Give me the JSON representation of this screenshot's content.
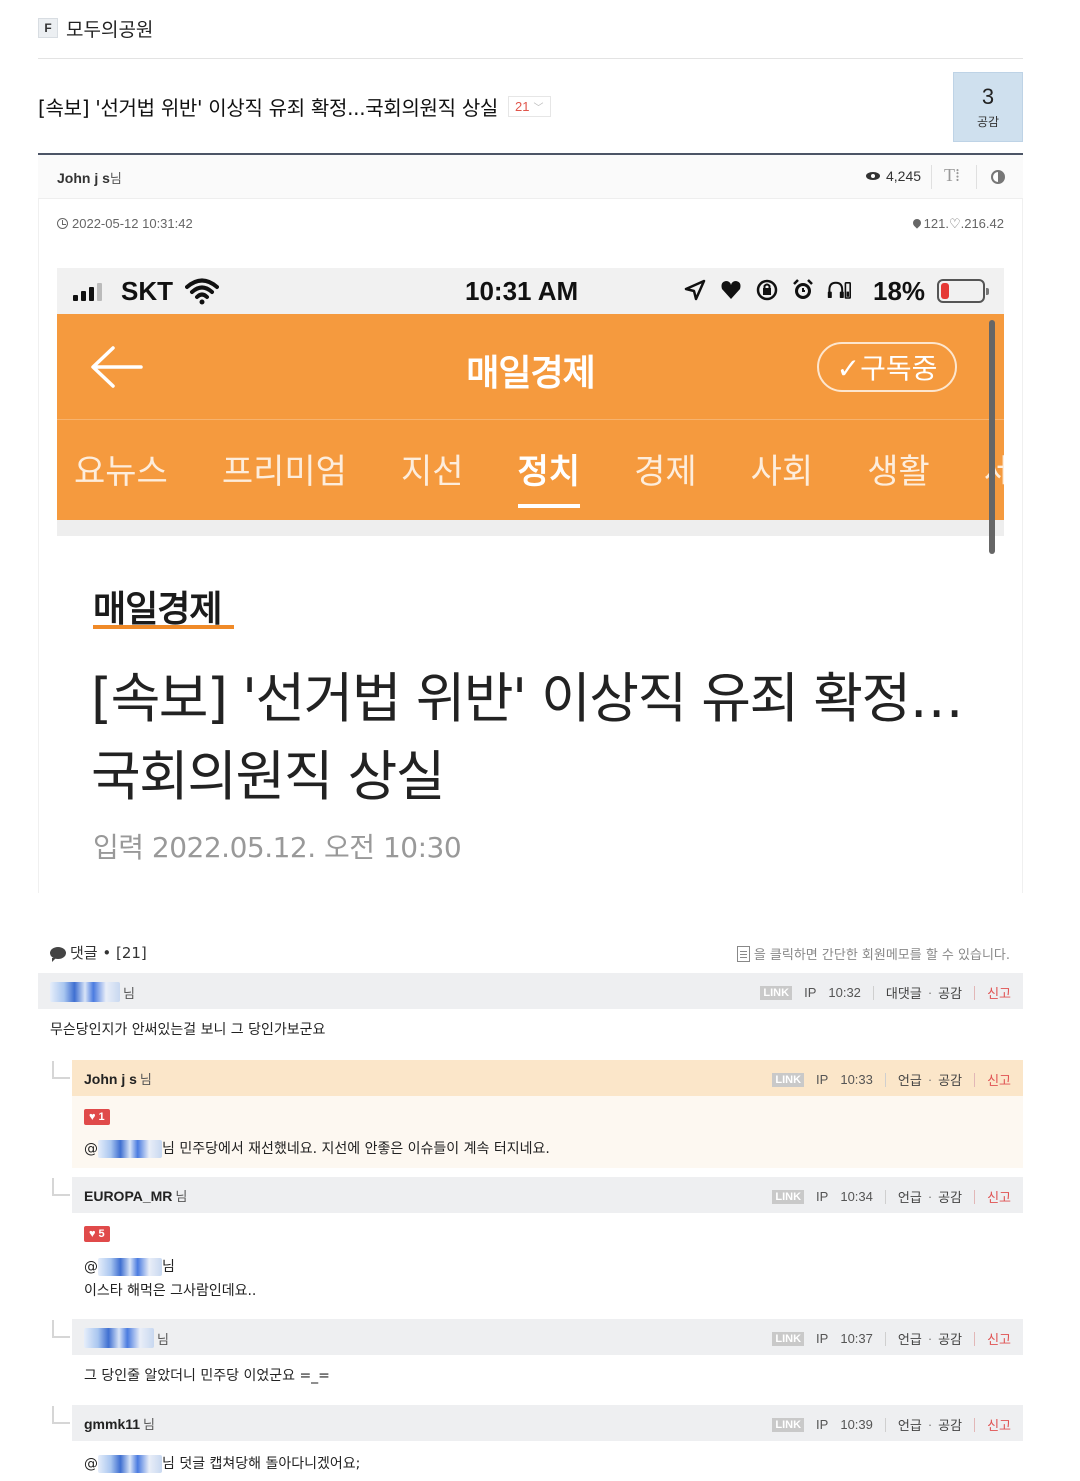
{
  "board": {
    "badge": "F",
    "name": "모두의공원"
  },
  "post": {
    "title": "[속보] '선거법 위반' 이상직 유죄 확정...국회의원직 상실",
    "comment_count": "21",
    "like_count": "3",
    "like_label": "공감",
    "author": "John j s",
    "author_suffix": "님",
    "views": "4,245",
    "font_tool": "T⁞",
    "date": "2022-05-12 10:31:42",
    "ip": "121.♡.216.42"
  },
  "screenshot": {
    "carrier": "SKT",
    "time": "10:31 AM",
    "battery": "18%",
    "app_title": "매일경제",
    "subscribe_label": "✓구독중",
    "tabs": [
      "요뉴스",
      "프리미엄",
      "지선",
      "정치",
      "경제",
      "사회",
      "생활",
      "세계"
    ],
    "active_tab": "정치",
    "logo": "매일경제",
    "headline": "[속보] '선거법 위반' 이상직 유죄 확정…국회의원직 상실",
    "input_date": "입력 2022.05.12. 오전 10:30"
  },
  "comments_header": {
    "label": "댓글 • [21]",
    "memo_tip": "을 클릭하면 간단한 회원메모를 할 수 있습니다."
  },
  "comment_labels": {
    "link": "LINK",
    "ip": "IP",
    "reply": "대댓글",
    "mention": "언급",
    "like": "공감",
    "report": "신고",
    "dot": "·",
    "nim": "님"
  },
  "comments": [
    {
      "user": "",
      "time": "10:32",
      "text": "무슨당인지가 안써있는걸 보니 그 당인가보군요"
    },
    {
      "user": "John j s",
      "time": "10:33",
      "likes": "1",
      "text_prefix": "@",
      "text": "님 민주당에서 재선했네요. 지선에 안좋은 이슈들이 계속 터지네요."
    },
    {
      "user": "EUROPA_MR",
      "time": "10:34",
      "likes": "5",
      "text_prefix": "@",
      "text_nim": "님",
      "text": "이스타 해먹은 그사람인데요.."
    },
    {
      "user": "",
      "time": "10:37",
      "text": "그 당인줄 알았더니 민주당 이었군요 =_="
    },
    {
      "user": "gmmk11",
      "time": "10:39",
      "text_prefix": "@",
      "text": "님 덧글 캡쳐당해 돌아다니겠어요;"
    }
  ]
}
